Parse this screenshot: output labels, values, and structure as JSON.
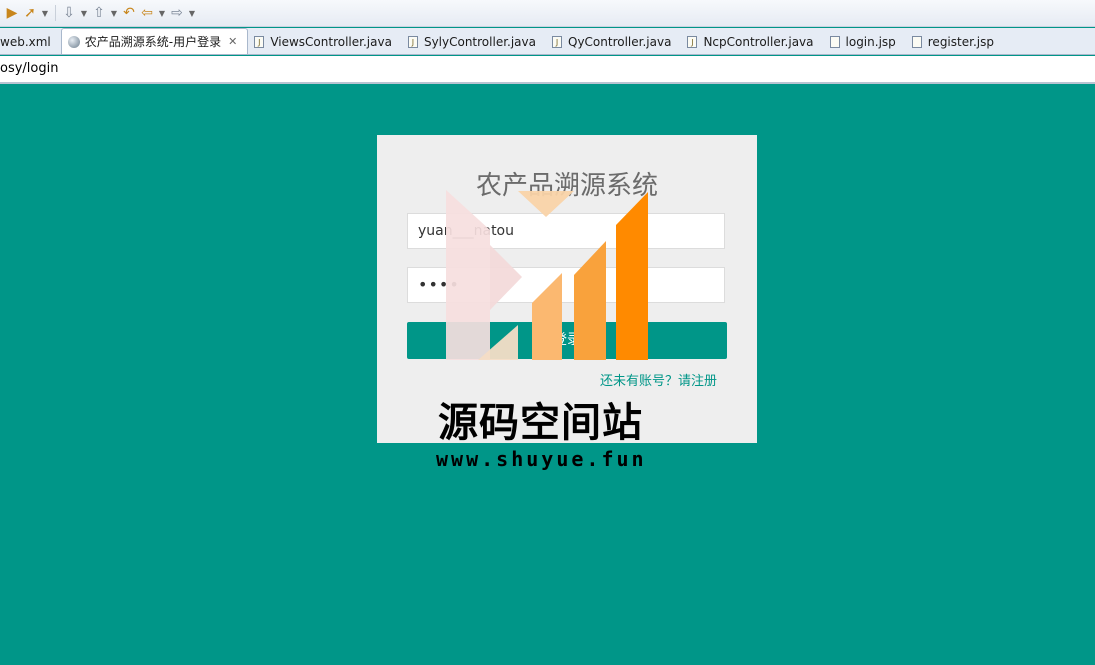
{
  "toolbar": {
    "icons": [
      "run-icon",
      "deploy-icon",
      "next-annotation-icon",
      "previous-annotation-icon",
      "back-icon",
      "forward-icon"
    ]
  },
  "tabs": [
    {
      "label": "web.xml",
      "icon": "file-icon",
      "active": false
    },
    {
      "label": "农产品溯源系统-用户登录",
      "icon": "globe-icon",
      "active": true
    },
    {
      "label": "ViewsController.java",
      "icon": "java-file-icon",
      "active": false
    },
    {
      "label": "SylyController.java",
      "icon": "java-file-icon",
      "active": false
    },
    {
      "label": "QyController.java",
      "icon": "java-file-icon",
      "active": false
    },
    {
      "label": "NcpController.java",
      "icon": "java-file-icon",
      "active": false
    },
    {
      "label": "login.jsp",
      "icon": "file-icon",
      "active": false
    },
    {
      "label": "register.jsp",
      "icon": "file-icon",
      "active": false
    }
  ],
  "url": "osy/login",
  "login": {
    "title": "农产品溯源系统",
    "username": "yuan___natou",
    "password": "••••",
    "submit_label": "登录",
    "register_link": "还未有账号？请注册"
  },
  "watermark": {
    "text": "源码空间站",
    "url": "www.shuyue.fun"
  },
  "colors": {
    "background": "#009688",
    "card": "#eeeeee",
    "accent": "#009688",
    "watermark_orange": "#ff8a00"
  }
}
